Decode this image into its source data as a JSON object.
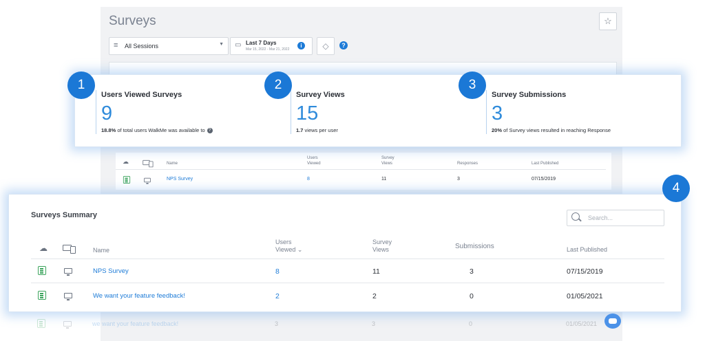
{
  "app": {
    "title": "Surveys"
  },
  "filters": {
    "sessions": "All Sessions",
    "date_range": "Last 7 Days",
    "date_sub": "Mar 15, 2022 - Mar 21, 2022"
  },
  "kpis": [
    {
      "badge": "1",
      "label": "Users Viewed Surveys",
      "value": "9",
      "desc_bold": "18.8%",
      "desc": "of total users WalkMe was available to"
    },
    {
      "badge": "2",
      "label": "Survey Views",
      "value": "15",
      "desc_bold": "1.7",
      "desc": "views per user"
    },
    {
      "badge": "3",
      "label": "Survey Submissions",
      "value": "3",
      "desc_bold": "20%",
      "desc": "of Survey views resulted in reaching Response"
    }
  ],
  "bg_table": {
    "headers": [
      "Name",
      "Users Viewed",
      "Survey Views",
      "Responses",
      "Last Published"
    ],
    "row": {
      "name": "NPS Survey",
      "users": "8",
      "views": "11",
      "responses": "3",
      "published": "07/15/2019"
    }
  },
  "summary": {
    "badge": "4",
    "title": "Surveys Summary",
    "search_placeholder": "Search...",
    "headers": {
      "name": "Name",
      "users_viewed": "Users Viewed",
      "survey_views": "Survey Views",
      "submissions": "Submissions",
      "last_published": "Last Published"
    },
    "rows": [
      {
        "name": "NPS Survey",
        "users_viewed": "8",
        "survey_views": "11",
        "submissions": "3",
        "last_published": "07/15/2019"
      },
      {
        "name": "We want your feature feedback!",
        "users_viewed": "2",
        "survey_views": "2",
        "submissions": "0",
        "last_published": "01/05/2021"
      }
    ],
    "faded_row": {
      "name": "we want your feature feedback!",
      "users_viewed": "3",
      "survey_views": "3",
      "submissions": "0",
      "last_published": "01/05/2021"
    }
  },
  "colors": {
    "accent": "#1b78d6",
    "survey_icon": "#3aa35b",
    "glow": "#82b4eb"
  },
  "icons": [
    "star-icon",
    "filter-icon",
    "calendar-icon",
    "tag-icon",
    "help-icon",
    "search-icon",
    "cloud-icon",
    "devices-icon",
    "survey-icon",
    "desktop-icon",
    "chat-icon"
  ]
}
